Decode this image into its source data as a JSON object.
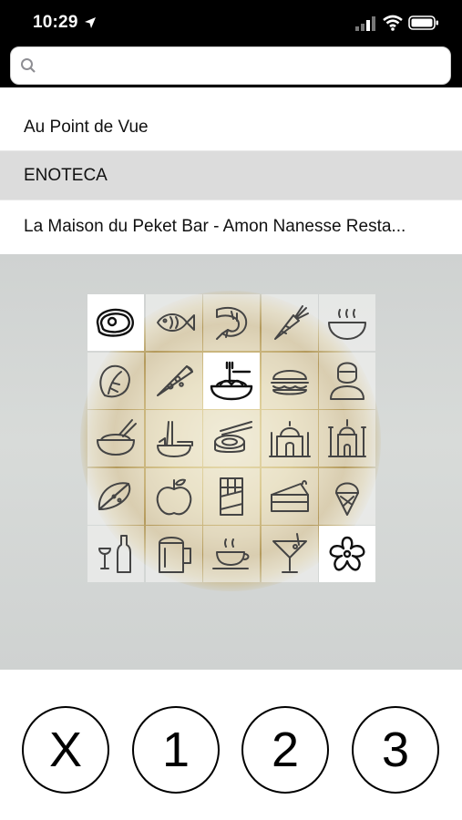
{
  "status_bar": {
    "time": "10:29",
    "location_icon": "location-arrow-icon",
    "signal_icon": "cellular-signal-icon",
    "wifi_icon": "wifi-icon",
    "battery_icon": "battery-icon"
  },
  "search": {
    "placeholder": "",
    "value": "",
    "icon": "search-icon"
  },
  "results": [
    {
      "label": "Au Point de Vue",
      "selected": false
    },
    {
      "label": "ENOTECA",
      "selected": true
    },
    {
      "label": "La Maison du Peket Bar - Amon Nanesse Resta...",
      "selected": false
    }
  ],
  "food_grid": [
    {
      "icon": "steak-icon",
      "selected": true
    },
    {
      "icon": "fish-icon",
      "selected": false
    },
    {
      "icon": "shrimp-icon",
      "selected": false
    },
    {
      "icon": "carrot-icon",
      "selected": false
    },
    {
      "icon": "soup-bowl-icon",
      "selected": false
    },
    {
      "icon": "lettuce-icon",
      "selected": false
    },
    {
      "icon": "pizza-icon",
      "selected": false
    },
    {
      "icon": "pasta-icon",
      "selected": true
    },
    {
      "icon": "burger-icon",
      "selected": false
    },
    {
      "icon": "chef-icon",
      "selected": false
    },
    {
      "icon": "rice-bowl-icon",
      "selected": false
    },
    {
      "icon": "noodle-bowl-icon",
      "selected": false
    },
    {
      "icon": "sushi-icon",
      "selected": false
    },
    {
      "icon": "taj-mahal-icon",
      "selected": false
    },
    {
      "icon": "mosque-icon",
      "selected": false
    },
    {
      "icon": "taco-icon",
      "selected": false
    },
    {
      "icon": "apple-icon",
      "selected": false
    },
    {
      "icon": "chocolate-bar-icon",
      "selected": false
    },
    {
      "icon": "cake-slice-icon",
      "selected": false
    },
    {
      "icon": "ice-cream-icon",
      "selected": false
    },
    {
      "icon": "wine-icon",
      "selected": false
    },
    {
      "icon": "beer-mug-icon",
      "selected": false
    },
    {
      "icon": "coffee-cup-icon",
      "selected": false
    },
    {
      "icon": "cocktail-icon",
      "selected": false
    },
    {
      "icon": "michelin-star-icon",
      "selected": true
    }
  ],
  "rating_buttons": [
    "X",
    "1",
    "2",
    "3"
  ]
}
